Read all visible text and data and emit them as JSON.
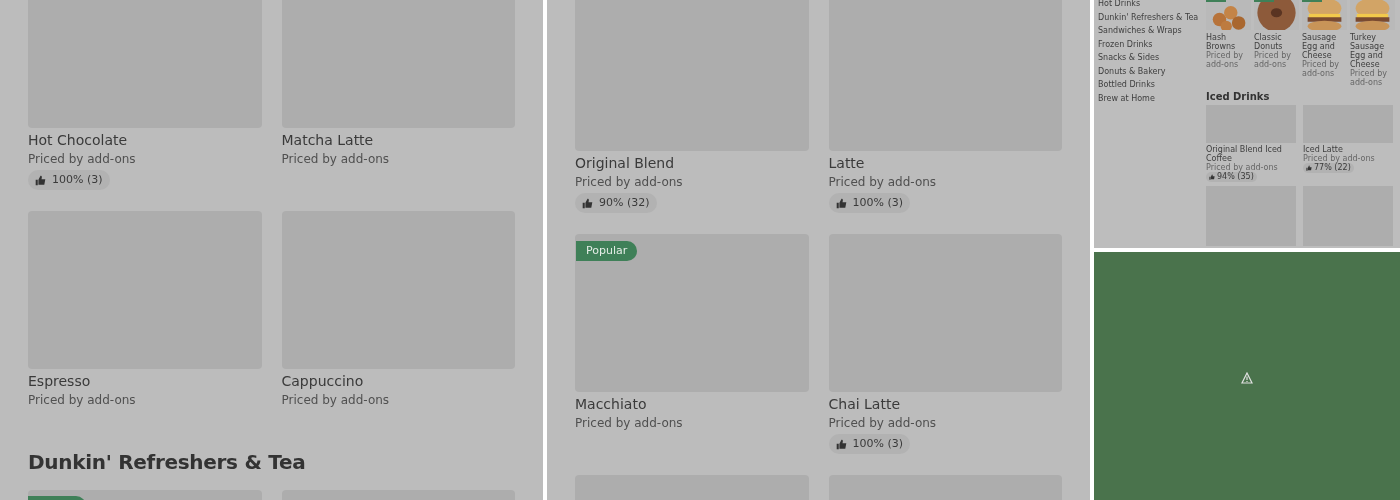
{
  "left_panel": {
    "blocks": [
      {
        "kind": "row",
        "items": [
          {
            "title": "Hot Chocolate",
            "subtitle": "Priced by add-ons",
            "rating": "100% (3)"
          },
          {
            "title": "Matcha Latte",
            "subtitle": "Priced by add-ons"
          }
        ]
      },
      {
        "kind": "row",
        "items": [
          {
            "title": "Espresso",
            "subtitle": "Priced by add-ons"
          },
          {
            "title": "Cappuccino",
            "subtitle": "Priced by add-ons"
          }
        ]
      },
      {
        "kind": "heading",
        "text": "Dunkin' Refreshers & Tea"
      },
      {
        "kind": "cut",
        "items": [
          {
            "tagged": true
          },
          {
            "tagged": false
          }
        ]
      }
    ]
  },
  "middle_panel": {
    "blocks": [
      {
        "kind": "row",
        "items": [
          {
            "title": "Original Blend",
            "subtitle": "Priced by add-ons",
            "rating": "90% (32)"
          },
          {
            "title": "Latte",
            "subtitle": "Priced by add-ons",
            "rating": "100% (3)"
          }
        ]
      },
      {
        "kind": "row",
        "items": [
          {
            "badge": "Popular",
            "title": "Macchiato",
            "subtitle": "Priced by add-ons"
          },
          {
            "title": "Chai Latte",
            "subtitle": "Priced by add-ons",
            "rating": "100% (3)"
          }
        ]
      },
      {
        "kind": "cut",
        "items": [
          {
            "tagged": false
          },
          {
            "tagged": false
          }
        ]
      }
    ]
  },
  "mini_page": {
    "sidebar": {
      "items": [
        "Hot Drinks",
        "Dunkin' Refreshers & Tea",
        "Sandwiches & Wraps",
        "Frozen Drinks",
        "Snacks & Sides",
        "Donuts & Bakery",
        "Bottled Drinks",
        "Brew at Home"
      ]
    },
    "top_products": [
      {
        "kind": "picture",
        "title": "Hash Browns",
        "subtitle": "Priced by add-ons",
        "tagged": true
      },
      {
        "kind": "picture",
        "title": "Classic Donuts",
        "subtitle": "Priced by add-ons",
        "tagged": true
      },
      {
        "kind": "picture",
        "title": "Sausage Egg and Cheese",
        "subtitle": "Priced by add-ons",
        "tagged": true
      },
      {
        "kind": "picture",
        "title": "Turkey Sausage Egg and Cheese",
        "subtitle": "Priced by add-ons",
        "tagged": false
      }
    ],
    "section_title": "Iced Drinks",
    "iced_products": [
      {
        "title": "Original Blend Iced Coffee",
        "subtitle": "Priced by add-ons",
        "rating": "94% (35)"
      },
      {
        "title": "Iced Latte",
        "subtitle": "Priced by add-ons",
        "rating": "77% (22)"
      }
    ]
  },
  "error_panel": {
    "kind": "warning"
  }
}
